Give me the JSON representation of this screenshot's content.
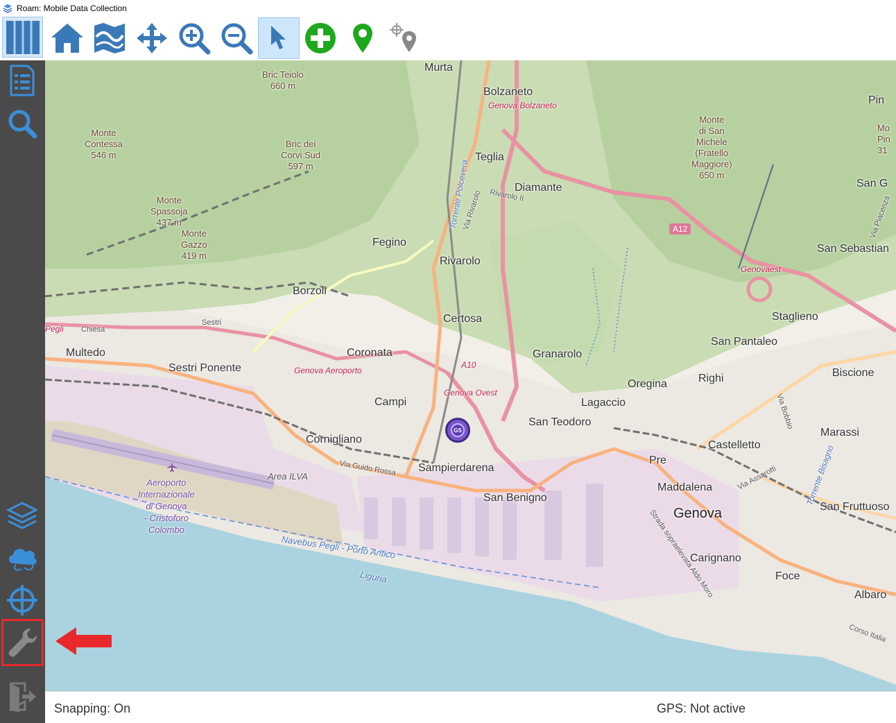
{
  "window": {
    "title": "Roam: Mobile Data Collection"
  },
  "toolbar": {
    "buttons": [
      {
        "icon": "home-icon"
      },
      {
        "icon": "map-extent-icon"
      },
      {
        "icon": "pan-icon"
      },
      {
        "icon": "zoom-in-icon"
      },
      {
        "icon": "zoom-out-icon"
      },
      {
        "icon": "select-pointer-icon",
        "active": true
      },
      {
        "icon": "add-feature-icon"
      },
      {
        "icon": "gps-marker-icon"
      },
      {
        "icon": "gps-locate-icon"
      }
    ]
  },
  "sidebar": {
    "top": [
      "map-icon",
      "data-form-icon",
      "search-icon"
    ],
    "bottom": [
      "layers-icon",
      "cloud-sync-icon",
      "gps-crosshair-icon",
      "settings-wrench-icon",
      "exit-icon"
    ],
    "highlighted": "settings-wrench-icon"
  },
  "map": {
    "labels": {
      "murta": "Murta",
      "bolzaneto": "Bolzaneto",
      "genova_bolzaneto": "Genova Bolzaneto",
      "teglia": "Teglia",
      "diamante": "Diamante",
      "fegino": "Fegino",
      "rivarolo": "Rivarolo",
      "borzoli": "Borzoli",
      "certosa": "Certosa",
      "coronata": "Coronata",
      "granarolo": "Granarolo",
      "multedo": "Multedo",
      "sestri_ponente": "Sestri Ponente",
      "genova_aeroporto": "Genova Aeroporto",
      "campi": "Campi",
      "genova_ovest": "Genova Ovest",
      "oregina": "Oregina",
      "righi": "Righi",
      "lagaccio": "Lagaccio",
      "san_teodoro": "San Teodoro",
      "cornigliano": "Cornigliano",
      "sampierdarena": "Sampierdarena",
      "san_benigno": "San Benigno",
      "area_ilva": "Area ILVA",
      "via_guido_rossa": "Via Guido Rossa",
      "pre": "Pre",
      "maddalena": "Maddalena",
      "genova": "Genova",
      "castelletto": "Castelletto",
      "carignano": "Carignano",
      "foce": "Foce",
      "albaro": "Albaro",
      "marassi": "Marassi",
      "san_fruttuoso": "San Fruttuoso",
      "biscione": "Biscione",
      "staglieno": "Staglieno",
      "san_pantaleo": "San Pantaleo",
      "san_sebastian": "San Sebastian",
      "genovaest": "Genovaest",
      "a12": "A12",
      "a10": "A10",
      "san_g": "San G",
      "pin": "Pin",
      "pegli": "Pegli",
      "chiesa": "Chiesa",
      "sestri_road": "Sestri",
      "rivarolo_ii": "Rivarolo II",
      "via_rivarolo": "Via Rivarolo",
      "via_assarotti": "Via Assarotti",
      "via_bobbio": "Via Bobbio",
      "torrente_bisagno": "Torrente Bisagno",
      "torrente_polcevera": "Torrente Polcevera",
      "corso_italia": "Corso Italia",
      "via_piacenza": "Via Piacenza",
      "strada_sopraelevata": "Strada sopraelevata Aldo Moro",
      "navebus": "Navebus Pegli - Porto Antico",
      "liguria": "Liguria",
      "bric_teiolo": "Bric Teiolo\n660 m",
      "monte_contessa": "Monte\nContessa\n546 m",
      "bric_dei_corvi": "Bric dei\nCorvi Sud\n597 m",
      "monte_spassoja": "Monte\nSpassoja\n437 m",
      "monte_gazzo": "Monte\nGazzo\n419 m",
      "monte_san_michele": "Monte\ndi San\nMichele\n(Fratello\nMaggiore)\n650 m",
      "monte_pin": "Mo\nPin\n31",
      "aeroporto": "Aeroporto\nInternazionale\ndi Genova\n- Cristoforo\nColombo"
    },
    "gps_marker_label": "GS",
    "colors": {
      "water": "#aad3df",
      "land": "#f2efe9",
      "forest": "#add19e",
      "motorway": "#e892a2",
      "primary": "#fcd6a4",
      "industrial": "#ebdbe8"
    }
  },
  "status": {
    "snapping": "Snapping: On",
    "gps": "GPS: Not active"
  }
}
